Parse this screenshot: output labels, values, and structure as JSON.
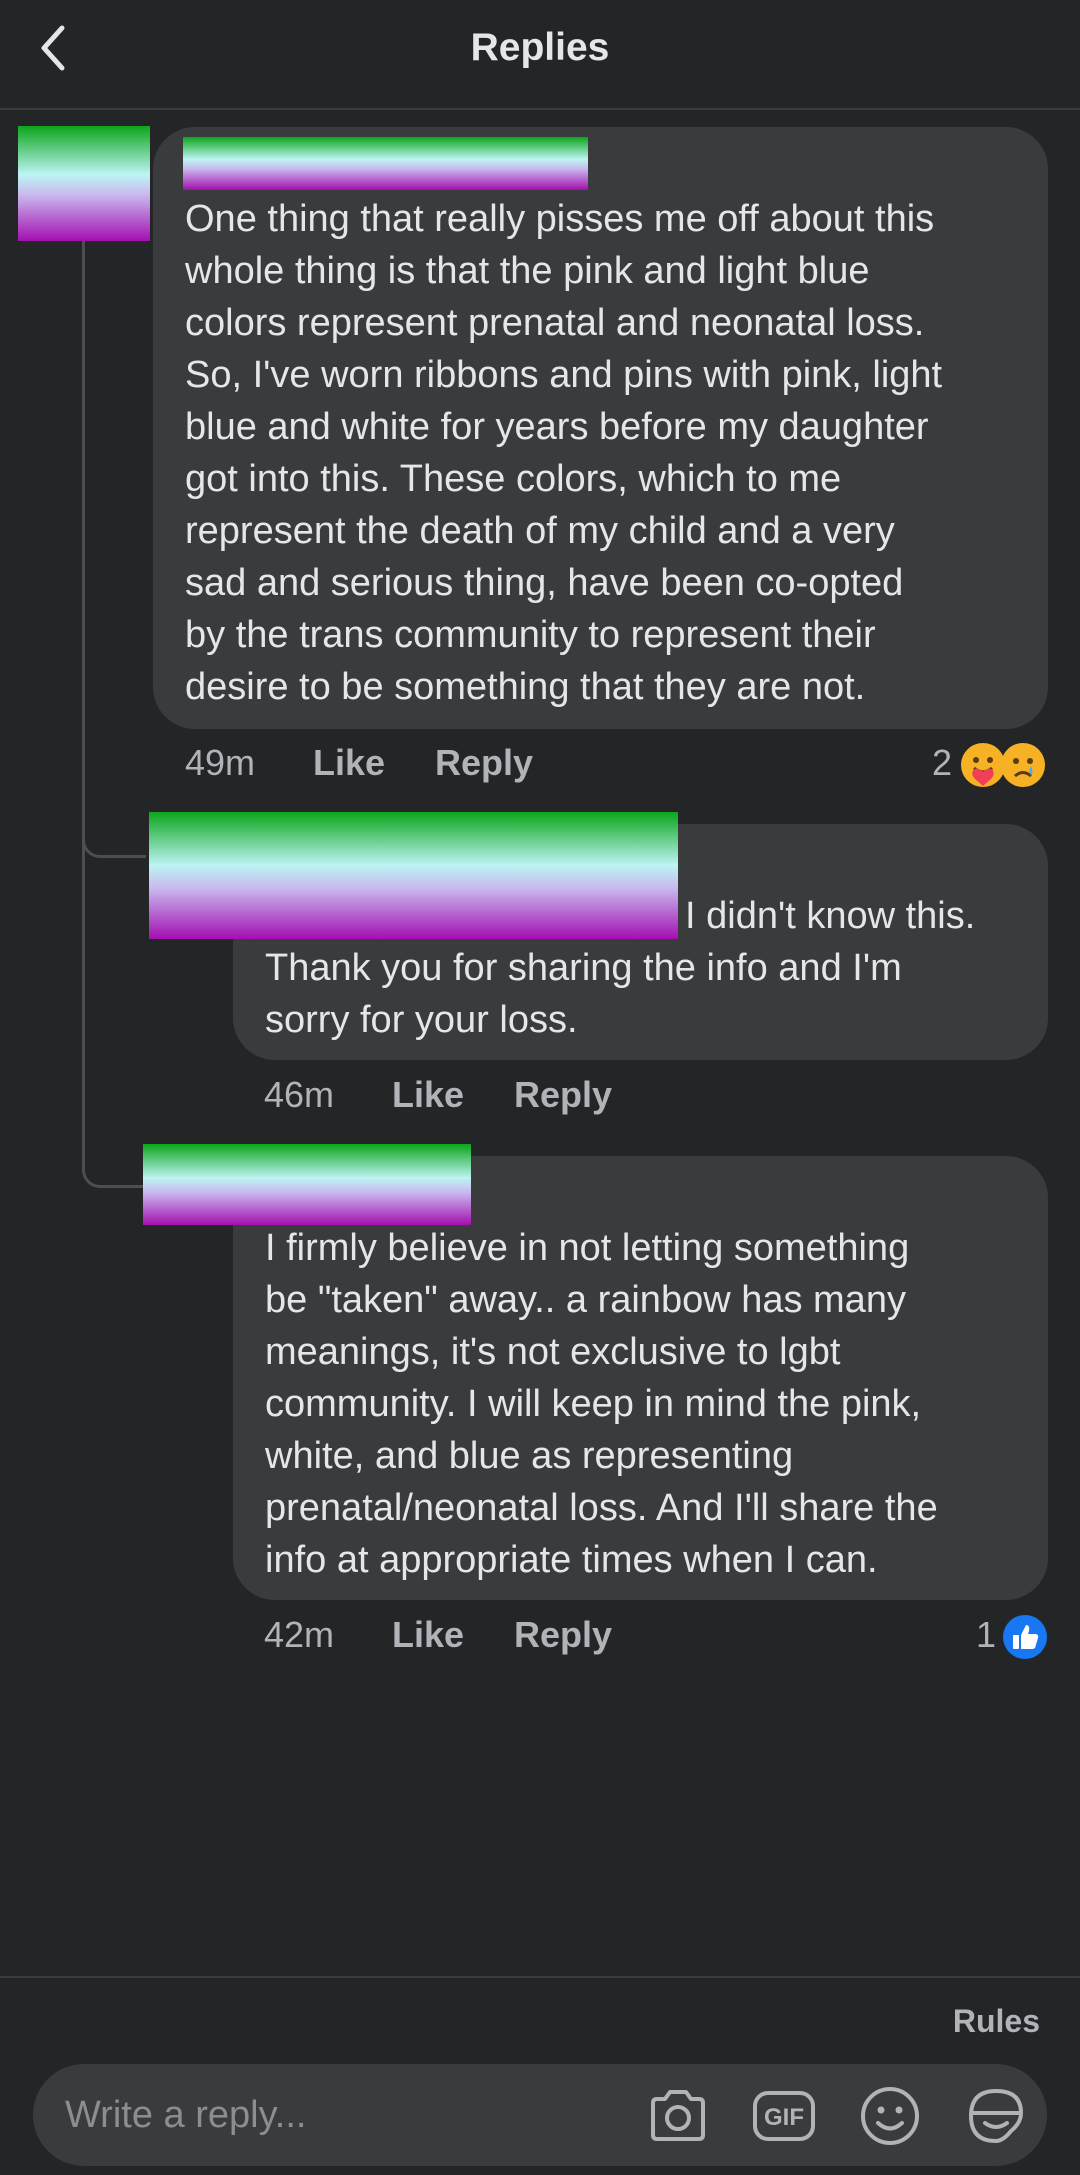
{
  "header": {
    "title": "Replies"
  },
  "comments": [
    {
      "text": "One thing that really pisses me off about this\nwhole thing is that the pink and light blue\ncolors represent prenatal and neonatal loss.\nSo, I've worn ribbons and pins with pink, light\nblue and white for years before my daughter\ngot into this. These colors, which to me\nrepresent the death of my child and a very\nsad and serious thing, have been co-opted\nby the trans community to represent their\ndesire to be something that they are not.",
      "time": "49m",
      "like": "Like",
      "reply": "Reply",
      "reaction_count": "2",
      "reaction_icons": [
        "love-hug-emoji-icon",
        "sad-emoji-icon"
      ]
    },
    {
      "text_first_line": "I didn't know this.",
      "text": "Thank you for sharing the info and I'm\nsorry for your loss.",
      "time": "46m",
      "like": "Like",
      "reply": "Reply"
    },
    {
      "text": "I firmly believe in not letting something\nbe \"taken\" away.. a rainbow has many\nmeanings, it's not exclusive to lgbt\ncommunity. I will keep in mind the pink,\nwhite, and blue as representing\nprenatal/neonatal loss. And I'll share the\ninfo at appropriate times when I can.",
      "time": "42m",
      "like": "Like",
      "reply": "Reply",
      "reaction_count": "1",
      "reaction_icons": [
        "like-thumbs-up-icon"
      ]
    }
  ],
  "footer": {
    "rules": "Rules"
  },
  "composer": {
    "placeholder": "Write a reply...",
    "gif_label": "GIF"
  },
  "colors": {
    "background": "#242527",
    "bubble": "#3a3b3c",
    "secondary_text": "#b0b3b8",
    "like_blue": "#1877f2",
    "censor_green": "#0ca51a",
    "censor_purple": "#a30fb0"
  }
}
